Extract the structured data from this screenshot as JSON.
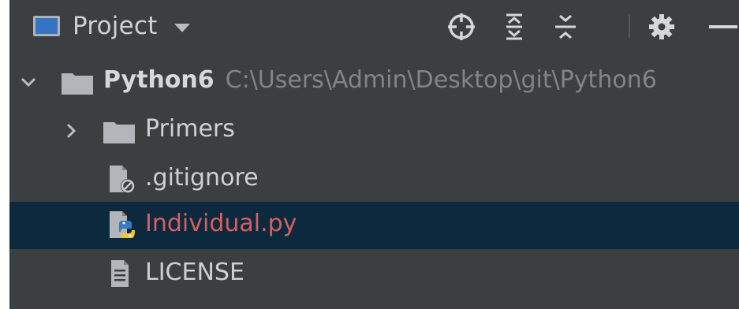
{
  "toolbar": {
    "title": "Project",
    "dropdown_icon": "caret-down-icon",
    "buttons": [
      {
        "name": "locate-file-icon"
      },
      {
        "name": "expand-all-icon"
      },
      {
        "name": "collapse-all-icon"
      },
      {
        "name": "settings-gear-icon"
      },
      {
        "name": "minimize-icon"
      }
    ]
  },
  "tree": {
    "root": {
      "name": "Python6",
      "path": "C:\\Users\\Admin\\Desktop\\git\\Python6",
      "expanded": true
    },
    "items": [
      {
        "label": "Primers",
        "type": "folder",
        "expanded": false
      },
      {
        "label": ".gitignore",
        "type": "ignored-file"
      },
      {
        "label": "Individual.py",
        "type": "python-file",
        "selected": true,
        "color": "#d75f5f"
      },
      {
        "label": "LICENSE",
        "type": "text-file"
      }
    ]
  },
  "colors": {
    "panel_bg": "#3c3f41",
    "selection_bg": "#0d293e",
    "text": "#cdd1d4",
    "path_text": "#7f8589",
    "modified_red": "#d75f5f"
  }
}
